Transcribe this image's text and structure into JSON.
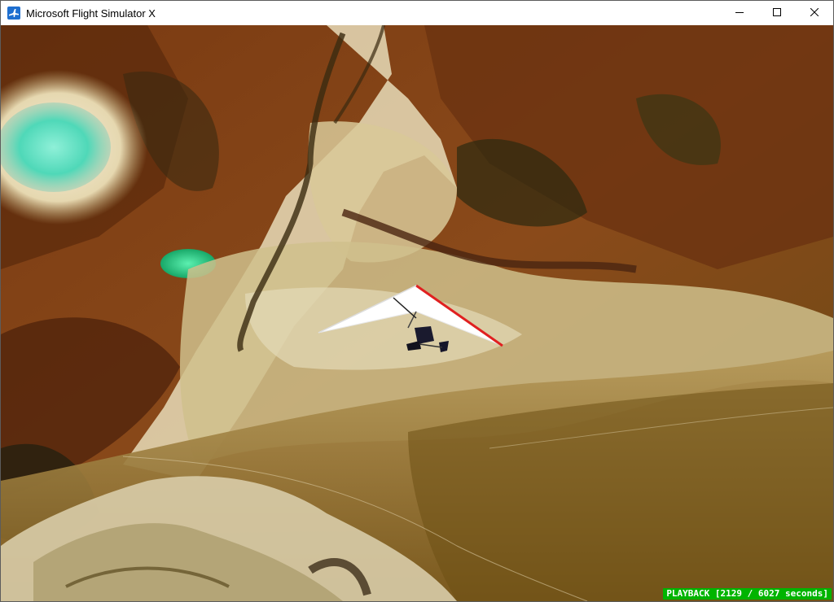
{
  "window": {
    "title": "Microsoft Flight Simulator X",
    "app_icon": "airplane-icon",
    "controls": {
      "minimize_icon": "minimize-icon",
      "maximize_icon": "maximize-icon",
      "close_icon": "close-icon"
    }
  },
  "scene": {
    "description_icon": "hang-glider-icon"
  },
  "status": {
    "playback_text": "PLAYBACK [2129 / 6027 seconds]"
  },
  "colors": {
    "status_bg": "#00b400",
    "status_text": "#ffffff"
  }
}
